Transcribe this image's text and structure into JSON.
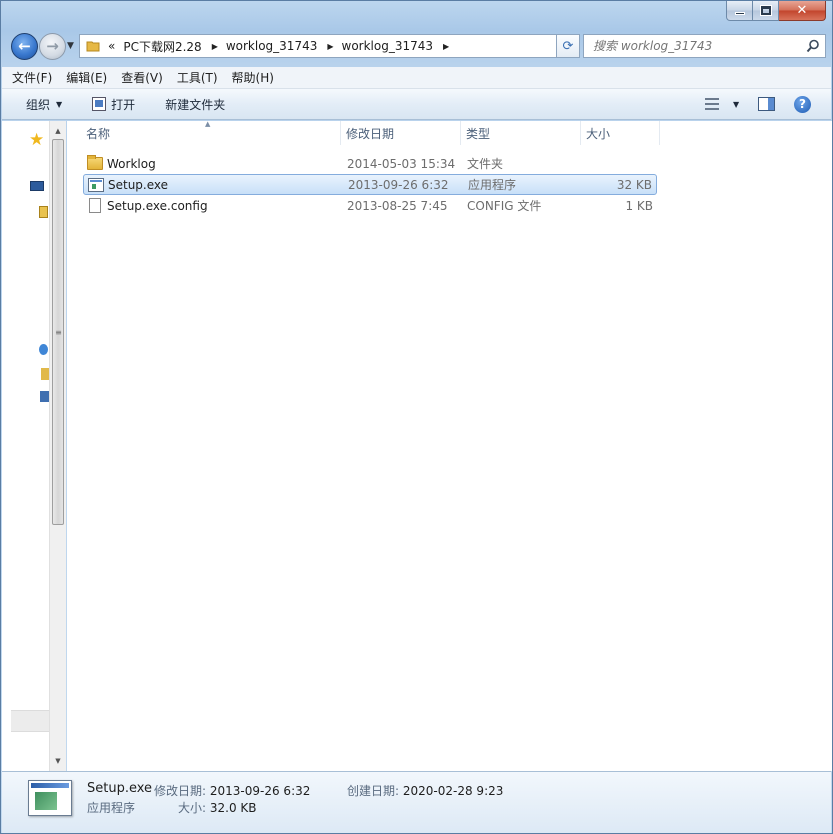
{
  "window": {
    "caption_buttons": {
      "minimize_icon": "minimize-icon",
      "maximize_icon": "maximize-icon",
      "close_glyph": "✕"
    }
  },
  "nav": {
    "back_glyph": "←",
    "forward_glyph": "→",
    "address": {
      "lead": "«",
      "crumbs": [
        "PC下载网2.28",
        "worklog_31743",
        "worklog_31743"
      ],
      "sep_glyph": "▶"
    },
    "refresh_glyph": "⟳",
    "search": {
      "placeholder": "搜索 worklog_31743"
    }
  },
  "menubar": {
    "items": [
      "文件(F)",
      "编辑(E)",
      "查看(V)",
      "工具(T)",
      "帮助(H)"
    ]
  },
  "toolbar": {
    "organize": "组织",
    "open": "打开",
    "new_folder": "新建文件夹",
    "help_glyph": "?"
  },
  "columns": {
    "name": "名称",
    "date": "修改日期",
    "type": "类型",
    "size": "大小"
  },
  "files": [
    {
      "name": "Worklog",
      "date": "2014-05-03 15:34",
      "type": "文件夹",
      "size": "",
      "icon": "folder-icon",
      "selected": false
    },
    {
      "name": "Setup.exe",
      "date": "2013-09-26 6:32",
      "type": "应用程序",
      "size": "32 KB",
      "icon": "exe-icon",
      "selected": true
    },
    {
      "name": "Setup.exe.config",
      "date": "2013-08-25 7:45",
      "type": "CONFIG 文件",
      "size": "1 KB",
      "icon": "document-icon",
      "selected": false
    }
  ],
  "details": {
    "filename": "Setup.exe",
    "filetype": "应用程序",
    "modified_label": "修改日期:",
    "modified_value": "2013-09-26 6:32",
    "created_label": "创建日期:",
    "created_value": "2020-02-28 9:23",
    "size_label": "大小:",
    "size_value": "32.0 KB"
  },
  "colors": {
    "selection_border": "#84acdd",
    "selection_fill": "#c8e0f8",
    "chrome": "#a9c8e8"
  }
}
